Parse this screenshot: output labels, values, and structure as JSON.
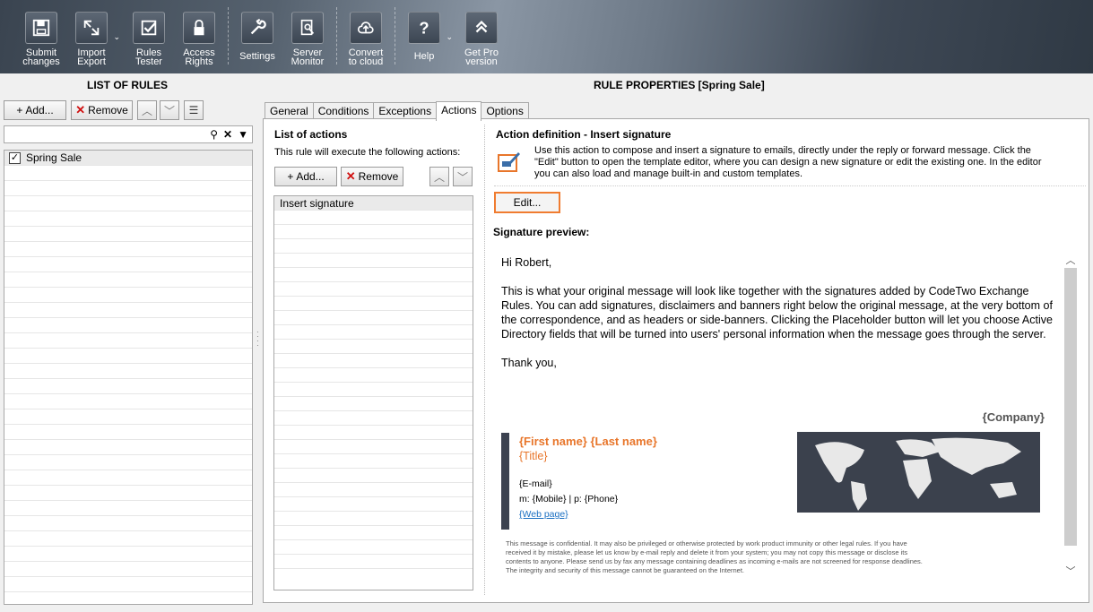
{
  "toolbar": {
    "items": [
      {
        "label_1": "Submit",
        "label_2": "changes",
        "icon": "save-icon"
      },
      {
        "label_1": "Import",
        "label_2": "Export",
        "icon": "import-export-icon"
      },
      {
        "label_1": "Rules",
        "label_2": "Tester",
        "icon": "checkmark-icon"
      },
      {
        "label_1": "Access",
        "label_2": "Rights",
        "icon": "lock-icon"
      },
      {
        "label_1": "Settings",
        "label_2": "",
        "icon": "wrench-icon"
      },
      {
        "label_1": "Server",
        "label_2": "Monitor",
        "icon": "monitor-icon"
      },
      {
        "label_1": "Convert",
        "label_2": "to cloud",
        "icon": "cloud-icon"
      },
      {
        "label_1": "Help",
        "label_2": "",
        "icon": "question-icon"
      },
      {
        "label_1": "Get Pro",
        "label_2": "version",
        "icon": "upgrade-icon"
      }
    ]
  },
  "left": {
    "title": "LIST OF RULES",
    "add_label": "Add...",
    "remove_label": "Remove",
    "rules": [
      {
        "name": "Spring Sale",
        "checked": true
      }
    ]
  },
  "right": {
    "title": "RULE PROPERTIES [Spring Sale]",
    "tabs": [
      "General",
      "Conditions",
      "Exceptions",
      "Actions",
      "Options"
    ],
    "active_tab": "Actions",
    "actions": {
      "heading": "List of actions",
      "subheading": "This rule will execute the following actions:",
      "add_label": "Add...",
      "remove_label": "Remove",
      "items": [
        "Insert signature"
      ]
    },
    "definition": {
      "title": "Action definition - Insert signature",
      "desc_1": "Use this action to compose and insert a signature to emails, directly under the reply or forward message. Click the",
      "desc_2": "\"Edit\" button to open the template editor, where you can design a new signature or edit the existing one. In the editor",
      "desc_3": "you can also load and manage built-in and custom templates.",
      "edit_label": "Edit...",
      "preview_label": "Signature preview:"
    },
    "preview": {
      "greeting": "Hi Robert,",
      "body": "This is what your original message will look like together with the signatures added by CodeTwo Exchange Rules. You can add signatures, disclaimers and banners right below the original message, at the very bottom of the correspondence, and as headers or side-banners. Clicking the Placeholder button will let you choose Active Directory fields that will be turned into users' personal information when the message goes through the server.",
      "thanks": "Thank you,",
      "company": "{Company}",
      "name": "{First name} {Last name}",
      "title": "{Title}",
      "email": "{E-mail}",
      "phones": "m:  {Mobile} | p: {Phone}",
      "web": "{Web page}",
      "legal": "This message is confidential. It may also be privileged or otherwise protected by work product immunity or other legal rules. If you have received it by mistake, please let us know by e-mail reply and delete it from your system; you may not copy this message or disclose its contents to anyone. Please send us by fax any message containing deadlines as incoming e-mails are not screened for response deadlines. The integrity and security of this message cannot be guaranteed on the Internet."
    }
  },
  "colors": {
    "accent_orange": "#e8762b",
    "edit_border": "#f07c30",
    "sig_bar": "#3c4250",
    "link": "#1a6fc2"
  }
}
